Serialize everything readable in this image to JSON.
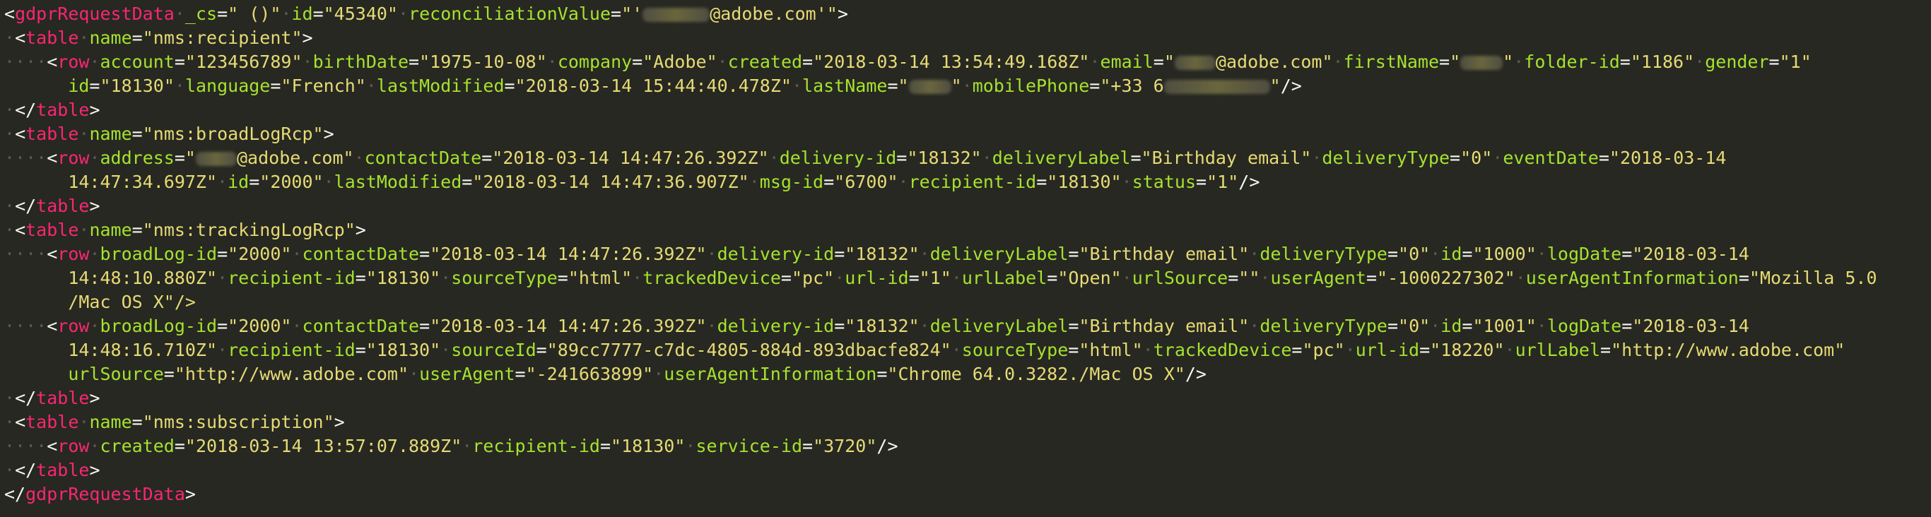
{
  "colors": {
    "background": "#272822",
    "tag": "#f92672",
    "attribute": "#a6e22e",
    "string": "#e6db74",
    "text": "#f8f8f2",
    "whitespace_marker": "#5a5b52"
  },
  "code": {
    "root_open": {
      "tag": "gdprRequestData",
      "attr_cs": "_cs",
      "val_cs": " ()",
      "attr_id": "id",
      "val_id": "45340",
      "attr_recon": "reconciliationValue",
      "val_recon_suffix": "@adobe.com'"
    },
    "recipient": {
      "table_tag": "table",
      "name_attr": "name",
      "name_val": "nms:recipient",
      "row_tag": "row",
      "fields_line1": [
        {
          "k": "account",
          "v": "123456789"
        },
        {
          "k": "birthDate",
          "v": "1975-10-08"
        },
        {
          "k": "company",
          "v": "Adobe"
        },
        {
          "k": "created",
          "v": "2018-03-14 13:54:49.168Z"
        },
        {
          "k": "email",
          "v": "@adobe.com",
          "blur_prefix": true
        },
        {
          "k": "firstName",
          "v": "",
          "blur_only": true
        },
        {
          "k": "folder-id",
          "v": "1186"
        },
        {
          "k": "gender",
          "v": "1"
        }
      ],
      "fields_line2": [
        {
          "k": "id",
          "v": "18130"
        },
        {
          "k": "language",
          "v": "French"
        },
        {
          "k": "lastModified",
          "v": "2018-03-14 15:44:40.478Z"
        },
        {
          "k": "lastName",
          "v": "",
          "blur_only": true
        },
        {
          "k": "mobilePhone",
          "v": "+33 6",
          "blur_suffix": true
        }
      ]
    },
    "broadLog": {
      "name_val": "nms:broadLogRcp",
      "fields_line1": [
        {
          "k": "address",
          "v": "@adobe.com",
          "blur_prefix": true
        },
        {
          "k": "contactDate",
          "v": "2018-03-14 14:47:26.392Z"
        },
        {
          "k": "delivery-id",
          "v": "18132"
        },
        {
          "k": "deliveryLabel",
          "v": "Birthday email"
        },
        {
          "k": "deliveryType",
          "v": "0"
        },
        {
          "k": "eventDate",
          "v": "2018-03-14",
          "open_end": true
        }
      ],
      "line2_lead": "14:47:34.697Z\"",
      "fields_line2": [
        {
          "k": "id",
          "v": "2000"
        },
        {
          "k": "lastModified",
          "v": "2018-03-14 14:47:36.907Z"
        },
        {
          "k": "msg-id",
          "v": "6700"
        },
        {
          "k": "recipient-id",
          "v": "18130"
        },
        {
          "k": "status",
          "v": "1"
        }
      ]
    },
    "tracking": {
      "name_val": "nms:trackingLogRcp",
      "row1_line1": [
        {
          "k": "broadLog-id",
          "v": "2000"
        },
        {
          "k": "contactDate",
          "v": "2018-03-14 14:47:26.392Z"
        },
        {
          "k": "delivery-id",
          "v": "18132"
        },
        {
          "k": "deliveryLabel",
          "v": "Birthday email"
        },
        {
          "k": "deliveryType",
          "v": "0"
        },
        {
          "k": "id",
          "v": "1000"
        },
        {
          "k": "logDate",
          "v": "2018-03-14",
          "open_end": true
        }
      ],
      "row1_line2_lead": "14:48:10.880Z\"",
      "row1_line2": [
        {
          "k": "recipient-id",
          "v": "18130"
        },
        {
          "k": "sourceType",
          "v": "html"
        },
        {
          "k": "trackedDevice",
          "v": "pc"
        },
        {
          "k": "url-id",
          "v": "1"
        },
        {
          "k": "urlLabel",
          "v": "Open"
        },
        {
          "k": "urlSource",
          "v": ""
        },
        {
          "k": "userAgent",
          "v": "-1000227302"
        },
        {
          "k": "userAgentInformation",
          "v": "Mozilla 5.0",
          "open_end": true
        }
      ],
      "row1_line3": "/Mac OS X\"/>",
      "row2_line1": [
        {
          "k": "broadLog-id",
          "v": "2000"
        },
        {
          "k": "contactDate",
          "v": "2018-03-14 14:47:26.392Z"
        },
        {
          "k": "delivery-id",
          "v": "18132"
        },
        {
          "k": "deliveryLabel",
          "v": "Birthday email"
        },
        {
          "k": "deliveryType",
          "v": "0"
        },
        {
          "k": "id",
          "v": "1001"
        },
        {
          "k": "logDate",
          "v": "2018-03-14",
          "open_end": true
        }
      ],
      "row2_line2_lead": "14:48:16.710Z\"",
      "row2_line2": [
        {
          "k": "recipient-id",
          "v": "18130"
        },
        {
          "k": "sourceId",
          "v": "89cc7777-c7dc-4805-884d-893dbacfe824"
        },
        {
          "k": "sourceType",
          "v": "html"
        },
        {
          "k": "trackedDevice",
          "v": "pc"
        },
        {
          "k": "url-id",
          "v": "18220"
        },
        {
          "k": "urlLabel",
          "v": "http://www.adobe.com"
        }
      ],
      "row2_line3": [
        {
          "k": "urlSource",
          "v": "http://www.adobe.com"
        },
        {
          "k": "userAgent",
          "v": "-241663899"
        },
        {
          "k": "userAgentInformation",
          "v": "Chrome 64.0.3282./Mac OS X"
        }
      ]
    },
    "subscription": {
      "name_val": "nms:subscription",
      "fields": [
        {
          "k": "created",
          "v": "2018-03-14 13:57:07.889Z"
        },
        {
          "k": "recipient-id",
          "v": "18130"
        },
        {
          "k": "service-id",
          "v": "3720"
        }
      ]
    },
    "root_close_tag": "gdprRequestData",
    "table_tag": "table",
    "row_tag": "row",
    "name_attr": "name"
  }
}
